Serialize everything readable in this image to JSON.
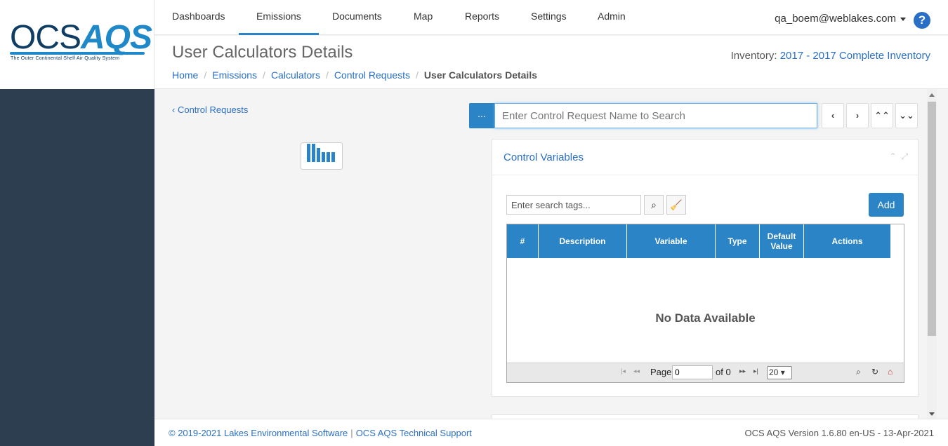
{
  "brand": {
    "logo_ocs": "OCS",
    "logo_aqs": "AQS",
    "tagline": "The Outer Continental Shelf Air Quality System"
  },
  "nav": {
    "items": [
      {
        "label": "Dashboards",
        "active": false
      },
      {
        "label": "Emissions",
        "active": true
      },
      {
        "label": "Documents",
        "active": false
      },
      {
        "label": "Map",
        "active": false
      },
      {
        "label": "Reports",
        "active": false
      },
      {
        "label": "Settings",
        "active": false
      },
      {
        "label": "Admin",
        "active": false
      }
    ],
    "user": "qa_boem@weblakes.com",
    "help_icon": "question-circle-icon"
  },
  "header": {
    "title": "User Calculators Details",
    "inventory_label": "Inventory:",
    "inventory_value": "2017 - 2017 Complete Inventory",
    "breadcrumb": [
      "Home",
      "Emissions",
      "Calculators",
      "Control Requests",
      "User Calculators Details"
    ]
  },
  "main": {
    "back_link": "Control Requests",
    "search": {
      "dots_label": "...",
      "placeholder": "Enter Control Request Name to Search"
    },
    "nav_buttons": [
      "‹",
      "›",
      "⌃⌃",
      "⌄⌄"
    ],
    "panel": {
      "title": "Control Variables",
      "tag_search_placeholder": "Enter search tags...",
      "add_label": "Add",
      "columns": [
        "#",
        "Description",
        "Variable",
        "Type",
        "Default Value",
        "Actions"
      ],
      "empty_text": "No Data Available",
      "pager": {
        "page_label": "Page",
        "page_value": "0",
        "of_label": "of 0",
        "page_size": "20"
      }
    }
  },
  "footer": {
    "copyright": "© 2019-2021 Lakes Environmental Software",
    "support": "OCS AQS Technical Support",
    "version": "OCS AQS Version 1.6.80 en-US - 13-Apr-2021"
  },
  "colors": {
    "primary": "#2a84c6",
    "link": "#2a6fc6",
    "sidebar": "#2c3e50"
  }
}
